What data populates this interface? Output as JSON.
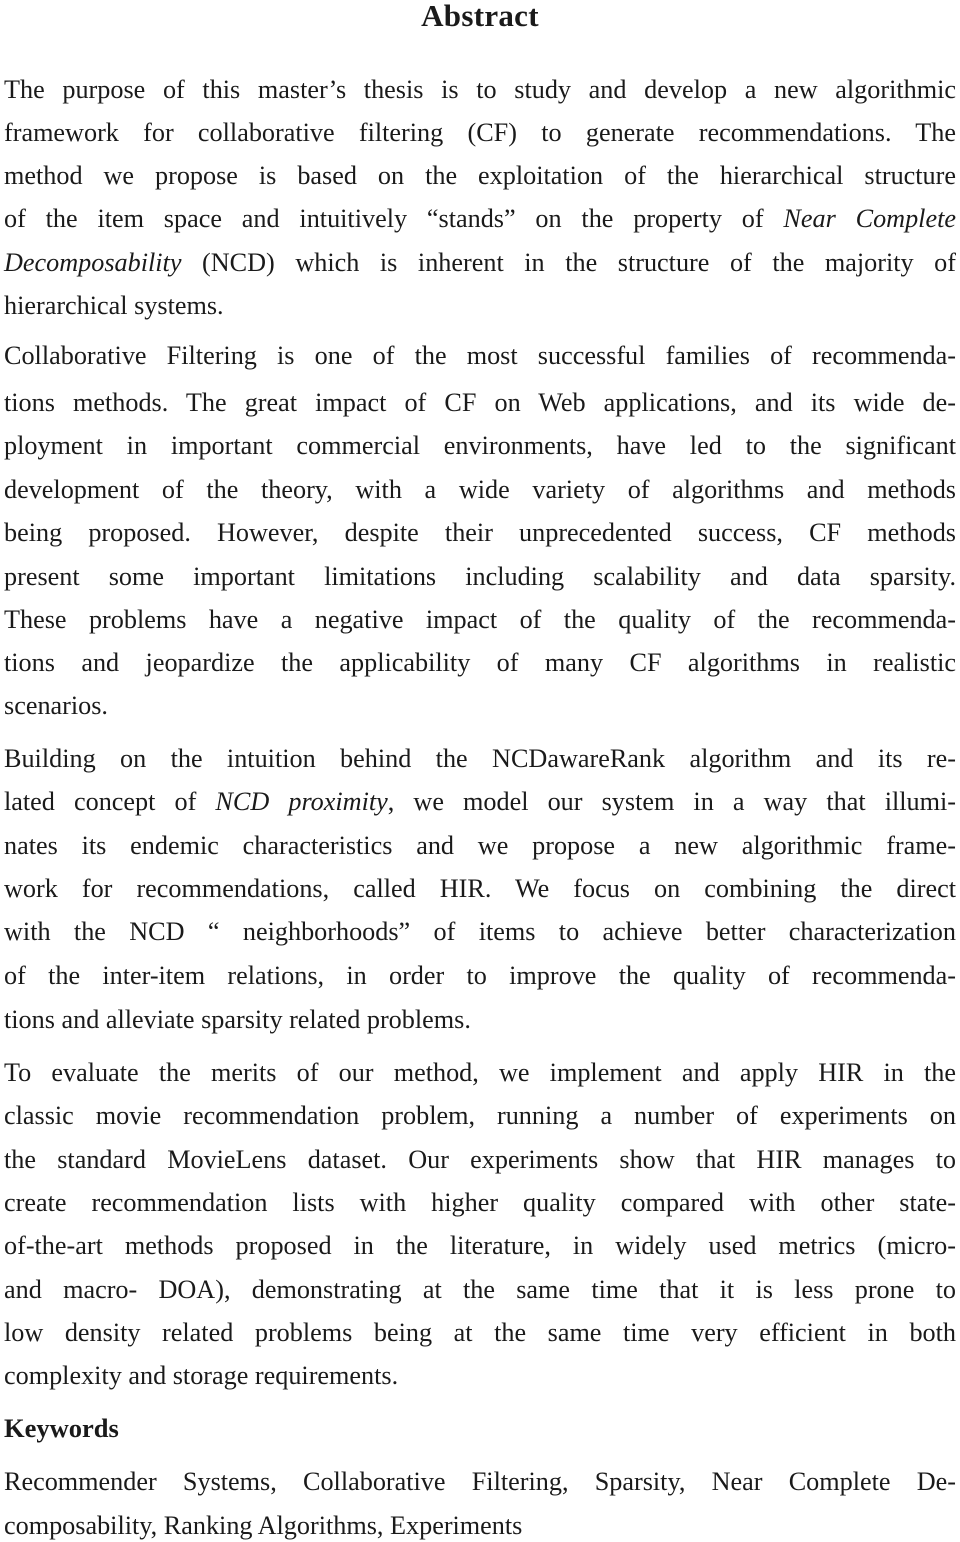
{
  "document": {
    "title": "Abstract",
    "paragraphs": [
      {
        "lines": [
          "The purpose of this master’s thesis is to study and develop a new algorithmic",
          "framework for collaborative filtering (CF) to generate recommendations. The",
          "method we propose is based on the exploitation of the hierarchical structure",
          [
            "of the item space and intuitively “stands” on the property of ",
            "Near Complete",
            ""
          ],
          [
            "",
            "Decomposability",
            " (NCD) which is inherent in the structure of the majority of"
          ],
          "hierarchical systems."
        ]
      },
      {
        "lines": [
          "Collaborative Filtering is one of the most successful families of recommenda-",
          "tions methods. The great impact of CF on Web applications, and its wide de-",
          "ployment in important commercial environments, have led to the significant",
          "development of the theory, with a wide variety of algorithms and methods",
          "being proposed. However, despite their unprecedented success, CF methods",
          "present some important limitations including scalability and data sparsity.",
          "These problems have a negative impact of the quality of the recommenda-",
          "tions and jeopardize the applicability of many CF algorithms in realistic",
          "scenarios."
        ]
      },
      {
        "lines": [
          "Building on the intuition behind the NCDawareRank algorithm and its re-",
          [
            "lated concept of ",
            "NCD proximity",
            ", we model our system in a way that illumi-"
          ],
          "nates its endemic characteristics and we propose a new algorithmic frame-",
          "work for recommendations, called HIR. We focus on combining the direct",
          "with the NCD “ neighborhoods” of items to achieve better characterization",
          "of the inter-item relations, in order to improve the quality of recommenda-",
          "tions and alleviate sparsity related problems."
        ]
      },
      {
        "lines": [
          "To evaluate the merits of our method, we implement and apply HIR in the",
          "classic movie recommendation problem, running a number of experiments on",
          "the standard MovieLens dataset. Our experiments show that HIR manages to",
          "create recommendation lists with higher quality compared with other state-",
          "of-the-art methods proposed in the literature, in widely used metrics (micro-",
          "and macro- DOA), demonstrating at the same time that it is less prone to",
          "low density related problems being at the same time very efficient in both",
          "complexity and storage requirements."
        ]
      }
    ],
    "keywords_heading": "Keywords",
    "keywords_lines": [
      "Recommender Systems, Collaborative Filtering, Sparsity, Near Complete De-",
      "composability, Ranking Algorithms, Experiments"
    ]
  }
}
